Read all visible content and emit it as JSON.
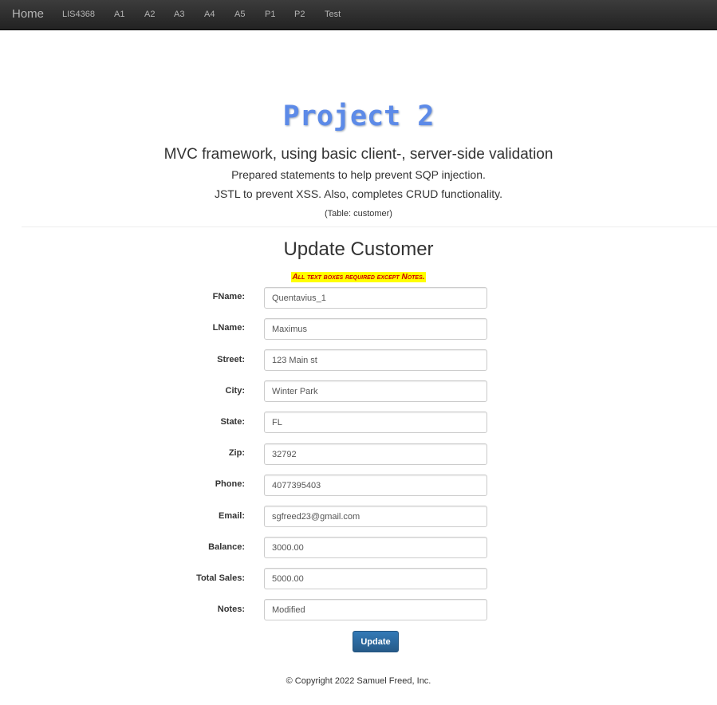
{
  "nav": {
    "brand": "Home",
    "items": [
      "LIS4368",
      "A1",
      "A2",
      "A3",
      "A4",
      "A5",
      "P1",
      "P2",
      "Test"
    ]
  },
  "header": {
    "title": "Project 2",
    "subtitle": "MVC framework, using basic client-, server-side validation",
    "line1": "Prepared statements to help prevent SQP injection.",
    "line2": "JSTL to prevent XSS. Also, completes CRUD functionality.",
    "table_note": "(Table: customer)"
  },
  "form": {
    "title": "Update Customer",
    "required_note": "All text boxes required except Notes.",
    "fields": [
      {
        "label": "FName:",
        "value": "Quentavius_1"
      },
      {
        "label": "LName:",
        "value": "Maximus"
      },
      {
        "label": "Street:",
        "value": "123 Main st"
      },
      {
        "label": "City:",
        "value": "Winter Park"
      },
      {
        "label": "State:",
        "value": "FL"
      },
      {
        "label": "Zip:",
        "value": "32792"
      },
      {
        "label": "Phone:",
        "value": "4077395403"
      },
      {
        "label": "Email:",
        "value": "sgfreed23@gmail.com"
      },
      {
        "label": "Balance:",
        "value": "3000.00"
      },
      {
        "label": "Total Sales:",
        "value": "5000.00"
      },
      {
        "label": "Notes:",
        "value": "Modified"
      }
    ],
    "submit_label": "Update"
  },
  "footer": {
    "copyright": "© Copyright 2022 Samuel Freed, Inc."
  },
  "colors": {
    "title": "#5c8ae8",
    "navbar": "#222222",
    "required_bg": "#ffff00",
    "required_text": "#cc0000",
    "button": "#337ab7"
  }
}
